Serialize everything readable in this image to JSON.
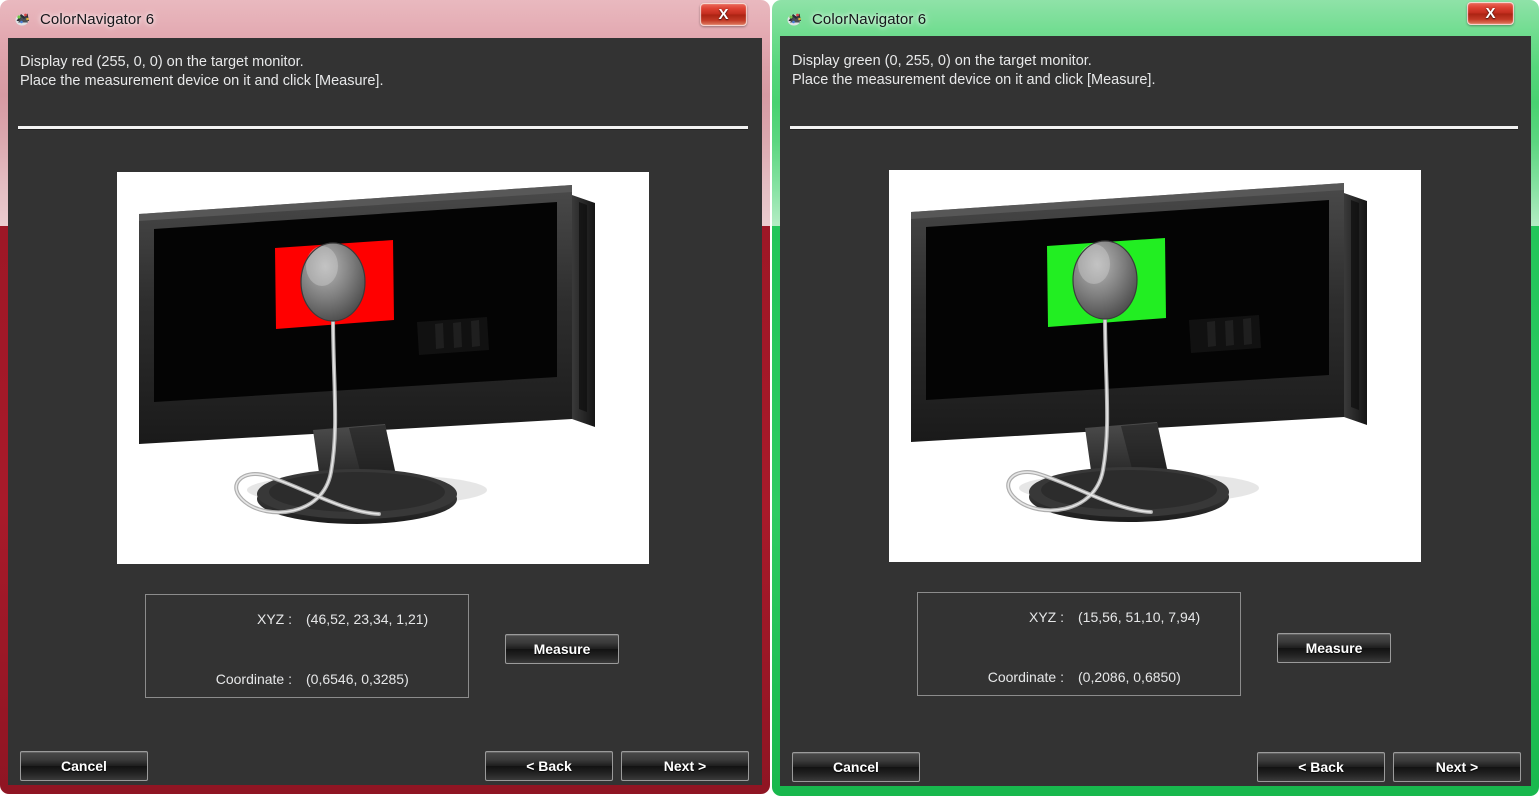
{
  "app": {
    "name": "ColorNavigator 6",
    "icon": "colornavigator-app-icon",
    "close_label": "X"
  },
  "windows": [
    {
      "id": "red-measurement-window",
      "accent_color": "#a81a2a",
      "frame_tint": "#d79aa3",
      "title": "ColorNavigator 6",
      "instruction_line1": "Display red (255, 0, 0) on the target monitor.",
      "instruction_line2": "Place the measurement device on it and click [Measure].",
      "patch_color": "#ff0000",
      "patch_name": "red-test-patch",
      "readout": {
        "xyz_label": "XYZ :",
        "xyz_value": "(46,52, 23,34, 1,21)",
        "coordinate_label": "Coordinate :",
        "coordinate_value": "(0,6546, 0,3285)"
      },
      "measure_label": "Measure",
      "cancel_label": "Cancel",
      "back_label": "< Back",
      "next_label": "Next >"
    },
    {
      "id": "green-measurement-window",
      "accent_color": "#22c55a",
      "frame_tint": "#48d271",
      "title": "ColorNavigator 6",
      "instruction_line1": "Display green (0, 255, 0) on the target monitor.",
      "instruction_line2": "Place the measurement device on it and click [Measure].",
      "patch_color": "#22ee22",
      "patch_name": "green-test-patch",
      "readout": {
        "xyz_label": "XYZ :",
        "xyz_value": "(15,56, 51,10, 7,94)",
        "coordinate_label": "Coordinate :",
        "coordinate_value": "(0,2086, 0,6850)"
      },
      "measure_label": "Measure",
      "cancel_label": "Cancel",
      "back_label": "< Back",
      "next_label": "Next >"
    }
  ]
}
